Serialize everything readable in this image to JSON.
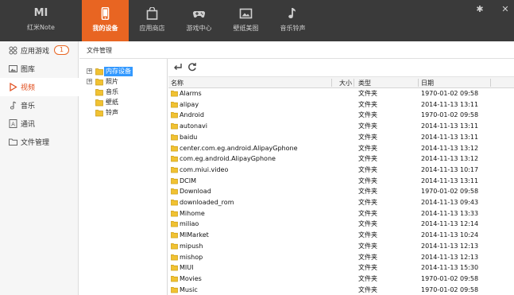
{
  "app": {
    "logo": "MI",
    "name": "红米Note"
  },
  "tabs": [
    {
      "label": "我的设备",
      "icon": "phone-icon",
      "active": true
    },
    {
      "label": "应用商店",
      "icon": "bag-icon"
    },
    {
      "label": "游戏中心",
      "icon": "gamepad-icon"
    },
    {
      "label": "壁纸美图",
      "icon": "picture-icon"
    },
    {
      "label": "音乐铃声",
      "icon": "music-note-icon"
    }
  ],
  "window_controls": {
    "settings": "✱",
    "close": "✕"
  },
  "sidebar": {
    "items": [
      {
        "label": "应用游戏",
        "icon": "apps-icon",
        "badge": "1"
      },
      {
        "label": "图库",
        "icon": "image-icon"
      },
      {
        "label": "视频",
        "icon": "play-icon",
        "active": true
      },
      {
        "label": "音乐",
        "icon": "music-icon"
      },
      {
        "label": "通讯",
        "icon": "contacts-icon"
      },
      {
        "label": "文件管理",
        "icon": "folder-icon"
      }
    ]
  },
  "breadcrumb": "文件管理",
  "tree": {
    "nodes": [
      {
        "label": "内存设备",
        "expander": "+",
        "selected": true
      },
      {
        "label": "照片",
        "expander": "+"
      },
      {
        "label": "音乐"
      },
      {
        "label": "壁纸"
      },
      {
        "label": "铃声"
      }
    ]
  },
  "toolbar": {
    "back_icon": "back-arrow-icon",
    "refresh_icon": "refresh-icon"
  },
  "list": {
    "columns": {
      "name": "名称",
      "size": "大小",
      "type": "类型",
      "date": "日期"
    },
    "rows": [
      {
        "name": "Alarms",
        "type": "文件夹",
        "date": "1970-01-02 09:58"
      },
      {
        "name": "alipay",
        "type": "文件夹",
        "date": "2014-11-13 13:11"
      },
      {
        "name": "Android",
        "type": "文件夹",
        "date": "1970-01-02 09:58"
      },
      {
        "name": "autonavi",
        "type": "文件夹",
        "date": "2014-11-13 13:11"
      },
      {
        "name": "baidu",
        "type": "文件夹",
        "date": "2014-11-13 13:11"
      },
      {
        "name": "center.com.eg.android.AlipayGphone",
        "type": "文件夹",
        "date": "2014-11-13 13:12"
      },
      {
        "name": "com.eg.android.AlipayGphone",
        "type": "文件夹",
        "date": "2014-11-13 13:12"
      },
      {
        "name": "com.miui.video",
        "type": "文件夹",
        "date": "2014-11-13 10:17"
      },
      {
        "name": "DCIM",
        "type": "文件夹",
        "date": "2014-11-13 13:11"
      },
      {
        "name": "Download",
        "type": "文件夹",
        "date": "1970-01-02 09:58"
      },
      {
        "name": "downloaded_rom",
        "type": "文件夹",
        "date": "2014-11-13 09:43"
      },
      {
        "name": "Mihome",
        "type": "文件夹",
        "date": "2014-11-13 13:33"
      },
      {
        "name": "miliao",
        "type": "文件夹",
        "date": "2014-11-13 12:14"
      },
      {
        "name": "MIMarket",
        "type": "文件夹",
        "date": "2014-11-13 10:24"
      },
      {
        "name": "mipush",
        "type": "文件夹",
        "date": "2014-11-13 12:13"
      },
      {
        "name": "mishop",
        "type": "文件夹",
        "date": "2014-11-13 12:13"
      },
      {
        "name": "MIUI",
        "type": "文件夹",
        "date": "2014-11-13 15:30"
      },
      {
        "name": "Movies",
        "type": "文件夹",
        "date": "1970-01-02 09:58"
      },
      {
        "name": "Music",
        "type": "文件夹",
        "date": "1970-01-02 09:58"
      }
    ]
  },
  "colors": {
    "topbar": "#3a3a3a",
    "accent": "#e86522",
    "selection": "#3399ff",
    "folder": "#f1c232"
  }
}
